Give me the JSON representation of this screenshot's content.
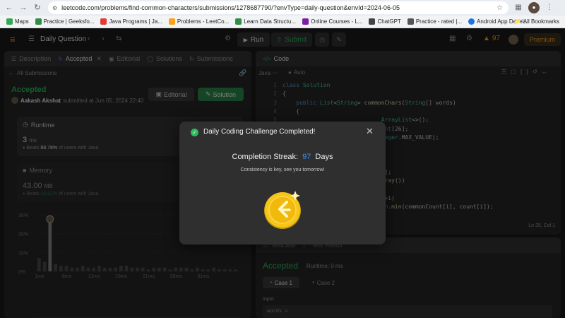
{
  "browser": {
    "url": "leetcode.com/problems/find-common-characters/submissions/1278687790/?envType=daily-question&envId=2024-06-05",
    "bookmarks": [
      {
        "label": "Maps",
        "color": "#34a853"
      },
      {
        "label": "Practice | Geeksfo...",
        "color": "#2f8d46"
      },
      {
        "label": "Java Programs | Ja...",
        "color": "#e53935"
      },
      {
        "label": "Problems - LeetCo...",
        "color": "#333333"
      },
      {
        "label": "Learn Data Structu...",
        "color": "#2f8d46"
      },
      {
        "label": "Online Courses - L...",
        "color": "#7b1fa2"
      },
      {
        "label": "ChatGPT",
        "color": "#444444"
      },
      {
        "label": "Practice - rated |...",
        "color": "#555555"
      },
      {
        "label": "Android App Devel...",
        "color": "#1a73e8"
      }
    ],
    "all_bookmarks": "All Bookmarks"
  },
  "nav": {
    "title": "Daily Question",
    "run": "Run",
    "submit": "Submit",
    "streak": "97",
    "premium": "Premium"
  },
  "left": {
    "tabs": [
      "Description",
      "Accepted",
      "Editorial",
      "Solutions",
      "Submissions"
    ],
    "all_submissions": "All Submissions",
    "status": "Accepted",
    "user": "Aakash Akshat",
    "submitted": "submitted at Jun 05, 2024 22:40",
    "editorial_btn": "Editorial",
    "solution_btn": "Solution",
    "runtime_label": "Runtime",
    "runtime_value": "3",
    "runtime_unit": "ms",
    "runtime_beats_prefix": "Beats",
    "runtime_beats": "88.78%",
    "runtime_beats_suffix": "of users with Java",
    "memory_label": "Memory",
    "memory_value": "43.00",
    "memory_unit": "MB",
    "memory_beats_prefix": "Beats",
    "memory_beats": "45.61%",
    "memory_beats_suffix": "of users with Java",
    "chart_ticks_y": [
      "30%",
      "20%",
      "10%",
      "0%"
    ],
    "chart_ticks_x": [
      "1ms",
      "6ms",
      "11ms",
      "16ms",
      "21ms",
      "26ms",
      "31ms"
    ]
  },
  "chart_data": {
    "type": "bar",
    "categories": [
      "1ms",
      "2ms",
      "3ms",
      "4ms",
      "5ms",
      "6ms",
      "7ms",
      "8ms",
      "9ms",
      "10ms",
      "11ms",
      "12ms",
      "13ms",
      "14ms",
      "15ms",
      "16ms",
      "17ms",
      "18ms",
      "19ms",
      "20ms",
      "21ms",
      "22ms",
      "23ms",
      "24ms",
      "25ms",
      "26ms",
      "27ms",
      "28ms",
      "29ms",
      "30ms",
      "31ms",
      "32ms",
      "33ms",
      "34ms",
      "35ms",
      "36ms",
      "37ms"
    ],
    "values": [
      7,
      5,
      27,
      4,
      3,
      3,
      2,
      2,
      3,
      2,
      2,
      3,
      2,
      2,
      2,
      3,
      3,
      2,
      2,
      2,
      1,
      2,
      2,
      2,
      1,
      2,
      2,
      2,
      1,
      2,
      1,
      1,
      2,
      1,
      1,
      1,
      1
    ],
    "ylim": [
      0,
      30
    ],
    "highlight": "3ms"
  },
  "right": {
    "code_tab": "Code",
    "language": "Java",
    "mode": "Auto",
    "lines": [
      {
        "n": "1",
        "html": "<span class=\"kw\">class</span> <span class=\"ty\">Solution</span>"
      },
      {
        "n": "2",
        "html": "{"
      },
      {
        "n": "3",
        "html": "    <span class=\"kw\">public</span> <span class=\"ty\">List</span>&lt;<span class=\"ty\">String</span>&gt; <span class=\"fn\">commonChars</span>(<span class=\"ty\">String</span>[] words)"
      },
      {
        "n": "4",
        "html": "    {"
      },
      {
        "n": "5",
        "html": "                             <span class=\"ty\">ArrayList</span>&lt;&gt;();"
      },
      {
        "n": "6",
        "html": "                             <span class=\"kw\">int</span>[26];"
      },
      {
        "n": "7",
        "html": "                         , <span class=\"ty\">Integer</span>.MAX_VALUE);"
      },
      {
        "n": "8",
        "html": ""
      },
      {
        "n": "9",
        "html": ""
      },
      {
        "n": "10",
        "html": ""
      },
      {
        "n": "11",
        "html": "                         <span class=\"kw\">nt</span>[26];"
      },
      {
        "n": "12",
        "html": "                         <span class=\"fn\">harArray</span>())"
      },
      {
        "n": "13",
        "html": "                         ;"
      },
      {
        "n": "14",
        "html": "                         26; ++i)"
      },
      {
        "n": "15",
        "html": "                         = <span class=\"ty\">Math</span>.<span class=\"fn\">min</span>(commonCount[i], count[i]);"
      }
    ],
    "cursor": "Ln 25, Col 1",
    "bottom_tabs": [
      "Testcase",
      "Test Result"
    ],
    "result_status": "Accepted",
    "result_runtime": "Runtime: 0 ms",
    "cases": [
      "Case 1",
      "Case 2"
    ],
    "input_label": "Input",
    "input_value": "words ="
  },
  "modal": {
    "title": "Daily Coding Challenge Completed!",
    "streak_label": "Completion Streak:",
    "streak_value": "97",
    "streak_unit": "Days",
    "message": "Consistency is key, see you tomorrow!"
  },
  "colors": {
    "accent_green": "#2cbb5d",
    "accent_orange": "#ffa116",
    "streak_blue": "#3c8cf0"
  }
}
